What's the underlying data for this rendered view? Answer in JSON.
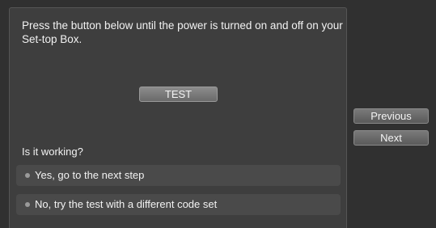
{
  "dialog": {
    "instruction": "Press the button below until the power is turned on and off on your Set-top Box.",
    "test_button_label": "TEST",
    "question": "Is it working?",
    "options": [
      {
        "label": "Yes, go to the next step"
      },
      {
        "label": "No, try the test with a different code set"
      }
    ]
  },
  "nav": {
    "previous_label": "Previous",
    "next_label": "Next"
  },
  "colors": {
    "panel_bg": "#3e3e3e",
    "screen_bg": "#303030",
    "option_bg": "#4a4a4a",
    "button_bg": "#7a7a7a",
    "text": "#f2f2f2"
  }
}
